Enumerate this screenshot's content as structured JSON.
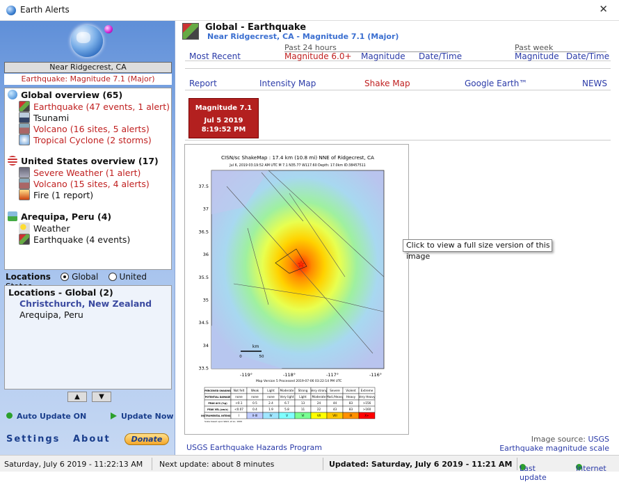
{
  "window": {
    "title": "Earth Alerts",
    "close_glyph": "✕"
  },
  "sidebar": {
    "location_name": "Near Ridgecrest, CA",
    "location_alert": "Earthquake: Magnitude 7.1 (Major)",
    "groups": [
      {
        "title": "Global overview (65)",
        "icon": "globe-icon",
        "items": [
          {
            "label": "Earthquake (47 events, 1 alert)",
            "alert": true,
            "icon": "earthquake-icon"
          },
          {
            "label": "Tsunami",
            "alert": false,
            "icon": "tsunami-icon"
          },
          {
            "label": "Volcano (16 sites, 5 alerts)",
            "alert": true,
            "icon": "volcano-icon"
          },
          {
            "label": "Tropical Cyclone (2 storms)",
            "alert": true,
            "icon": "cyclone-icon"
          }
        ]
      },
      {
        "title": "United States overview (17)",
        "icon": "us-flag-icon",
        "items": [
          {
            "label": "Severe Weather (1 alert)",
            "alert": true,
            "icon": "severe-weather-icon"
          },
          {
            "label": "Volcano (15 sites, 4 alerts)",
            "alert": true,
            "icon": "volcano-icon"
          },
          {
            "label": "Fire (1 report)",
            "alert": false,
            "icon": "fire-icon"
          }
        ]
      },
      {
        "title": "Arequipa, Peru (4)",
        "icon": "landscape-icon",
        "items": [
          {
            "label": "Weather",
            "alert": false,
            "icon": "weather-icon"
          },
          {
            "label": "Earthquake (4 events)",
            "alert": false,
            "icon": "earthquake-icon"
          }
        ]
      }
    ],
    "locations": {
      "label": "Locations",
      "options": [
        "Global",
        "United States"
      ],
      "selected": "Global",
      "list_header": "Locations - Global (2)",
      "list": [
        "Christchurch, New Zealand",
        "Arequipa, Peru"
      ]
    },
    "auto_update": "Auto Update ON",
    "update_now": "Update Now",
    "settings": "Settings",
    "about": "About",
    "donate": "Donate"
  },
  "main": {
    "title": "Global - Earthquake",
    "subtitle": "Near Ridgecrest, CA - Magnitude 7.1 (Major)",
    "nav": {
      "most_recent": "Most Recent",
      "past24_label": "Past 24 hours",
      "past24_magnitude": "Magnitude 6.0+",
      "past24_col_mag": "Magnitude",
      "past24_col_date": "Date/Time",
      "pastweek_label": "Past week",
      "pastweek_mag": "Magnitude",
      "pastweek_date": "Date/Time"
    },
    "links": [
      "Report",
      "Intensity Map",
      "Shake Map",
      "Google Earth™",
      "NEWS"
    ],
    "event": {
      "magnitude": "Magnitude 7.1",
      "date": "Jul 5 2019",
      "time": "8:19:52 PM"
    },
    "shakemap": {
      "title": "CISN/sc ShakeMap : 17.4 km (10.8 mi) NNE of Ridgecrest, CA",
      "subtitle": "Jul  6, 2019 03:19:52 AM UTC   M 7.1   N35.77 W117.60   Depth: 17.0km   ID:38457511",
      "lat_ticks": [
        "37.5",
        "37",
        "36.5",
        "36",
        "35.5",
        "35",
        "34.5",
        "34",
        "33.5"
      ],
      "lon_ticks": [
        "-119°",
        "-118°",
        "-117°",
        "-116°"
      ],
      "scale_label": "km",
      "scale_ticks": [
        "0",
        "50"
      ],
      "processed": "Map Version 5 Processed 2019-07-06 03:22:14 PM UTC",
      "legend_rows": [
        "PERCEIVED SHAKING",
        "POTENTIAL DAMAGE",
        "PEAK ACC.(%g)",
        "PEAK VEL.(cm/s)",
        "INSTRUMENTAL INTENSITY"
      ],
      "legend_shaking": [
        "Not felt",
        "Weak",
        "Light",
        "Moderate",
        "Strong",
        "Very strong",
        "Severe",
        "Violent",
        "Extreme"
      ],
      "legend_damage": [
        "none",
        "none",
        "none",
        "Very light",
        "Light",
        "Moderate",
        "Mod./Heavy",
        "Heavy",
        "Very Heavy"
      ],
      "legend_acc": [
        "<0.1",
        "0.5",
        "2.4",
        "6.7",
        "13",
        "24",
        "44",
        "83",
        ">156"
      ],
      "legend_vel": [
        "<0.07",
        "0.4",
        "1.9",
        "5.8",
        "11",
        "22",
        "43",
        "83",
        ">160"
      ],
      "legend_intensity": [
        "I",
        "II-III",
        "IV",
        "V",
        "VI",
        "VII",
        "VIII",
        "IX",
        "X+"
      ],
      "legend_colors": [
        "#ffffff",
        "#bfccff",
        "#a0e6ff",
        "#80ffff",
        "#7aff93",
        "#ffff00",
        "#ffc800",
        "#ff9100",
        "#ff0000"
      ],
      "legend_note": "Scale based upon Wald, et al.; 1999"
    },
    "tooltip": "Click to view a full size version of this image",
    "source_link": "USGS Earthquake Hazards Program",
    "image_source_label": "Image source:",
    "image_source": "USGS",
    "magnitude_scale": "Earthquake magnitude scale"
  },
  "status": {
    "date": "Saturday, July 6 2019 - 11:22:13 AM",
    "next_update": "Next update: about 8 minutes",
    "updated": "Updated: Saturday, July 6 2019 - 11:21 AM",
    "last_update": "Last update",
    "internet": "Internet"
  }
}
